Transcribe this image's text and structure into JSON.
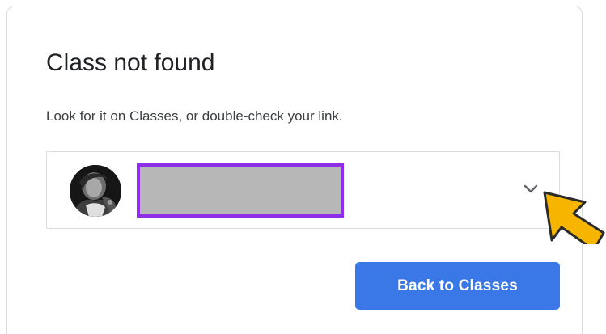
{
  "dialog": {
    "title": "Class not found",
    "message": "Look for it on Classes, or double-check your link."
  },
  "account_selector": {
    "avatar_icon": "user-avatar",
    "name": "",
    "name_redacted": true,
    "chevron_icon": "chevron-down-icon"
  },
  "annotation": {
    "icon": "arrow-icon",
    "color": "#f7b500"
  },
  "actions": {
    "back_label": "Back to Classes"
  },
  "colors": {
    "primary": "#3b78e7",
    "redaction_border": "#8e2ee6",
    "redaction_fill": "#b8b7b8"
  }
}
